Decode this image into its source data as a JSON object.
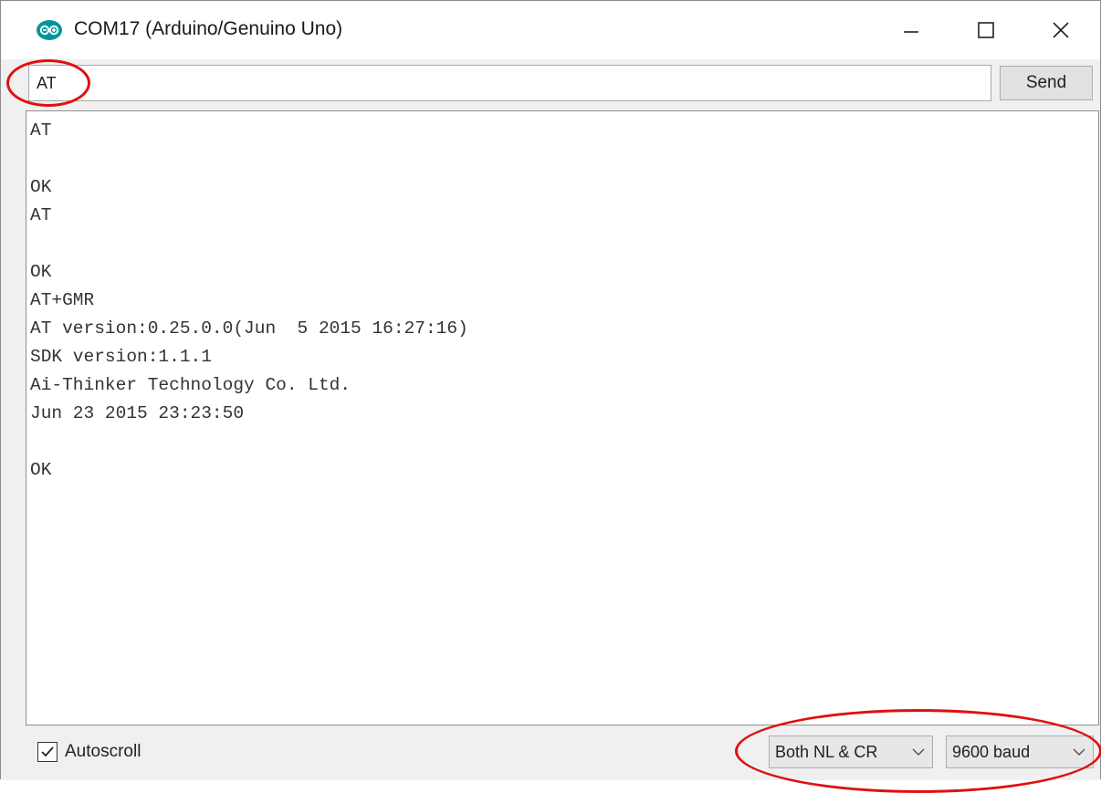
{
  "window": {
    "title": "COM17 (Arduino/Genuino Uno)",
    "app_icon": "arduino-logo-icon",
    "controls": [
      "minimize-icon",
      "maximize-icon",
      "close-icon"
    ]
  },
  "send_row": {
    "input_value": "AT",
    "send_label": "Send"
  },
  "output": {
    "lines": [
      "AT",
      "",
      "OK",
      "AT",
      "",
      "OK",
      "AT+GMR",
      "AT version:0.25.0.0(Jun  5 2015 16:27:16)",
      "SDK version:1.1.1",
      "Ai-Thinker Technology Co. Ltd.",
      "Jun 23 2015 23:23:50",
      "",
      "OK"
    ]
  },
  "bottom_bar": {
    "autoscroll_label": "Autoscroll",
    "autoscroll_checked": true,
    "line_ending": "Both NL & CR",
    "baud_rate": "9600 baud"
  },
  "colors": {
    "arduino_teal": "#00979c",
    "annotation_red": "#e01010"
  }
}
